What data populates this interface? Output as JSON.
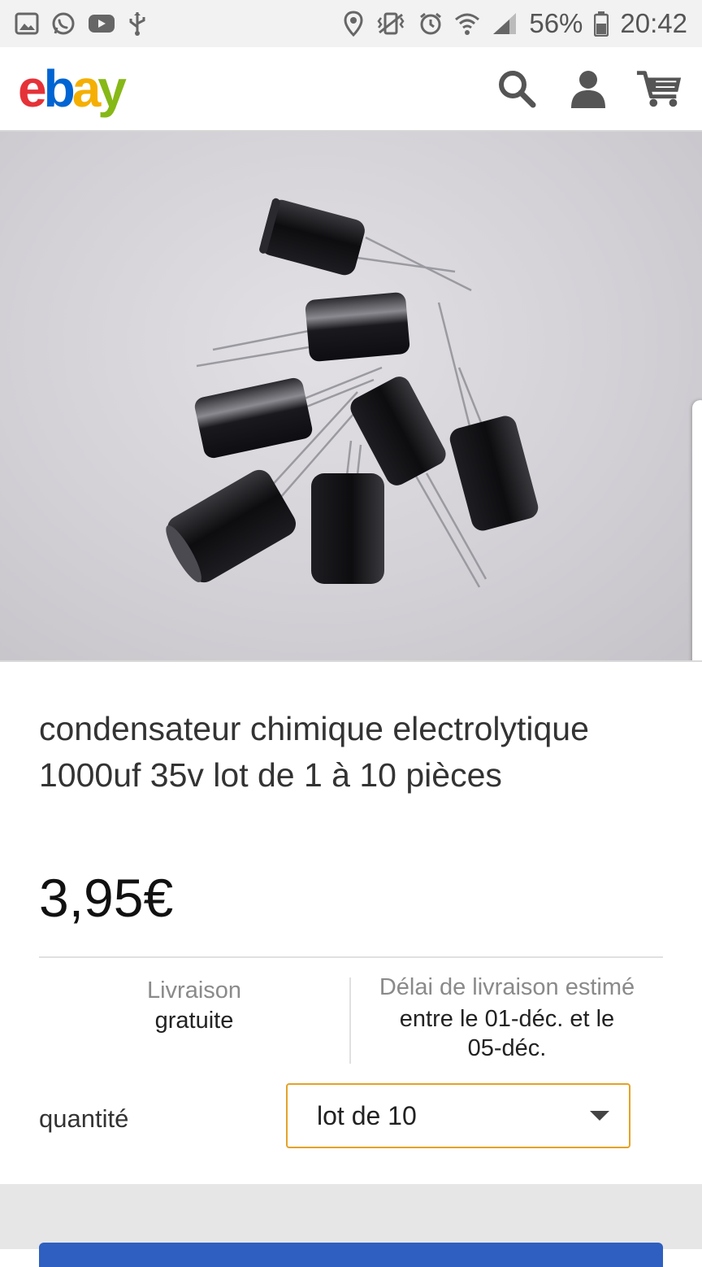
{
  "status_bar": {
    "battery": "56%",
    "time": "20:42",
    "icons_left": [
      "gallery-icon",
      "whatsapp-icon",
      "youtube-icon",
      "usb-debug-icon"
    ],
    "icons_right": [
      "location-icon",
      "vibrate-icon",
      "alarm-icon",
      "wifi-icon",
      "signal-icon",
      "battery-icon"
    ]
  },
  "header": {
    "logo_letters": [
      "e",
      "b",
      "a",
      "y"
    ],
    "logo_colors": [
      "#e53238",
      "#0064d2",
      "#f5af02",
      "#86b817"
    ],
    "icons": [
      "search-icon",
      "user-icon",
      "cart-icon"
    ]
  },
  "product": {
    "title": "condensateur chimique electrolytique 1000uf 35v lot de 1 à 10 pièces",
    "price": "3,95€"
  },
  "shipping": {
    "label": "Livraison",
    "value": "gratuite"
  },
  "delivery": {
    "label": "Délai de livraison estimé",
    "value_line1": "entre le 01-déc. et le",
    "value_line2": "05-déc."
  },
  "quantity": {
    "label": "quantité",
    "selected": "lot de 10"
  },
  "colors": {
    "accent_border": "#e5a228",
    "buy_button": "#2f5fc0"
  }
}
